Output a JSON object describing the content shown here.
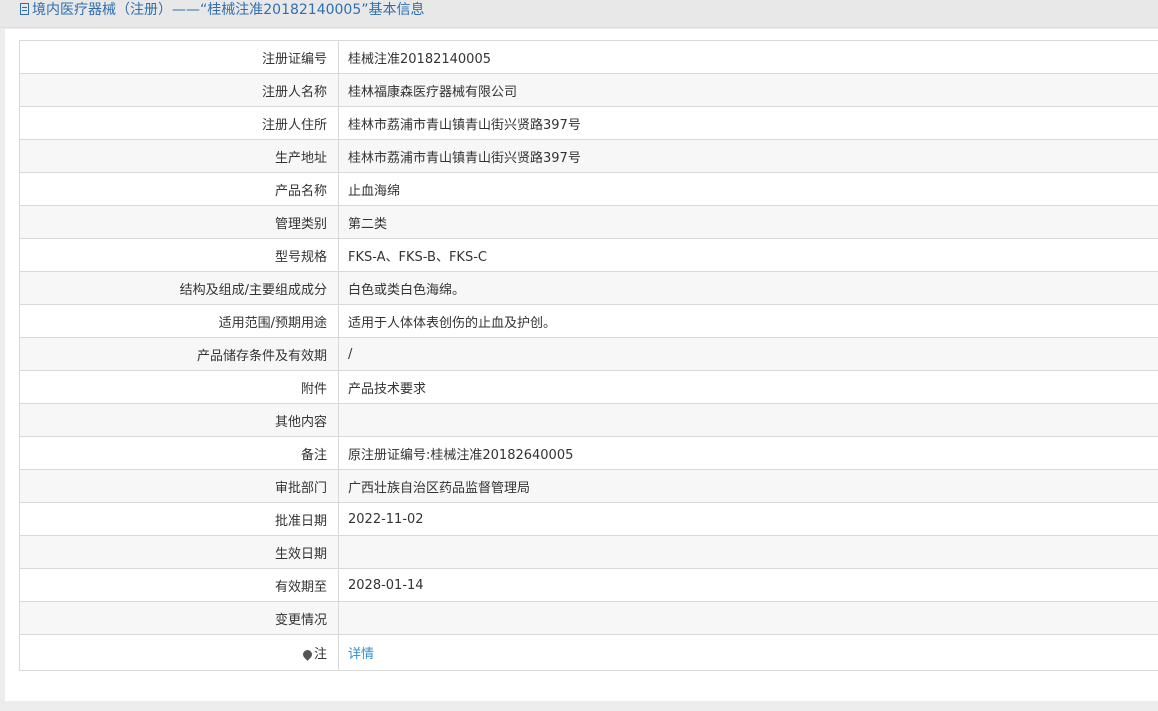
{
  "header": {
    "title": "境内医疗器械（注册）——“桂械注准20182140005”基本信息"
  },
  "rows": [
    {
      "label": "注册证编号",
      "value": "桂械注准20182140005"
    },
    {
      "label": "注册人名称",
      "value": "桂林福康森医疗器械有限公司"
    },
    {
      "label": "注册人住所",
      "value": "桂林市荔浦市青山镇青山街兴贤路397号"
    },
    {
      "label": "生产地址",
      "value": "桂林市荔浦市青山镇青山街兴贤路397号"
    },
    {
      "label": "产品名称",
      "value": "止血海绵"
    },
    {
      "label": "管理类别",
      "value": "第二类"
    },
    {
      "label": "型号规格",
      "value": "FKS-A、FKS-B、FKS-C"
    },
    {
      "label": "结构及组成/主要组成成分",
      "value": "白色或类白色海绵。"
    },
    {
      "label": "适用范围/预期用途",
      "value": "适用于人体体表创伤的止血及护创。"
    },
    {
      "label": "产品储存条件及有效期",
      "value": "/"
    },
    {
      "label": "附件",
      "value": "产品技术要求"
    },
    {
      "label": "其他内容",
      "value": ""
    },
    {
      "label": "备注",
      "value": "原注册证编号:桂械注准20182640005"
    },
    {
      "label": "审批部门",
      "value": "广西壮族自治区药品监督管理局"
    },
    {
      "label": "批准日期",
      "value": "2022-11-02"
    },
    {
      "label": "生效日期",
      "value": ""
    },
    {
      "label": "有效期至",
      "value": "2028-01-14"
    },
    {
      "label": "变更情况",
      "value": ""
    }
  ],
  "note_row": {
    "label": "注",
    "icon": "pin-icon",
    "link_text": "详情"
  }
}
